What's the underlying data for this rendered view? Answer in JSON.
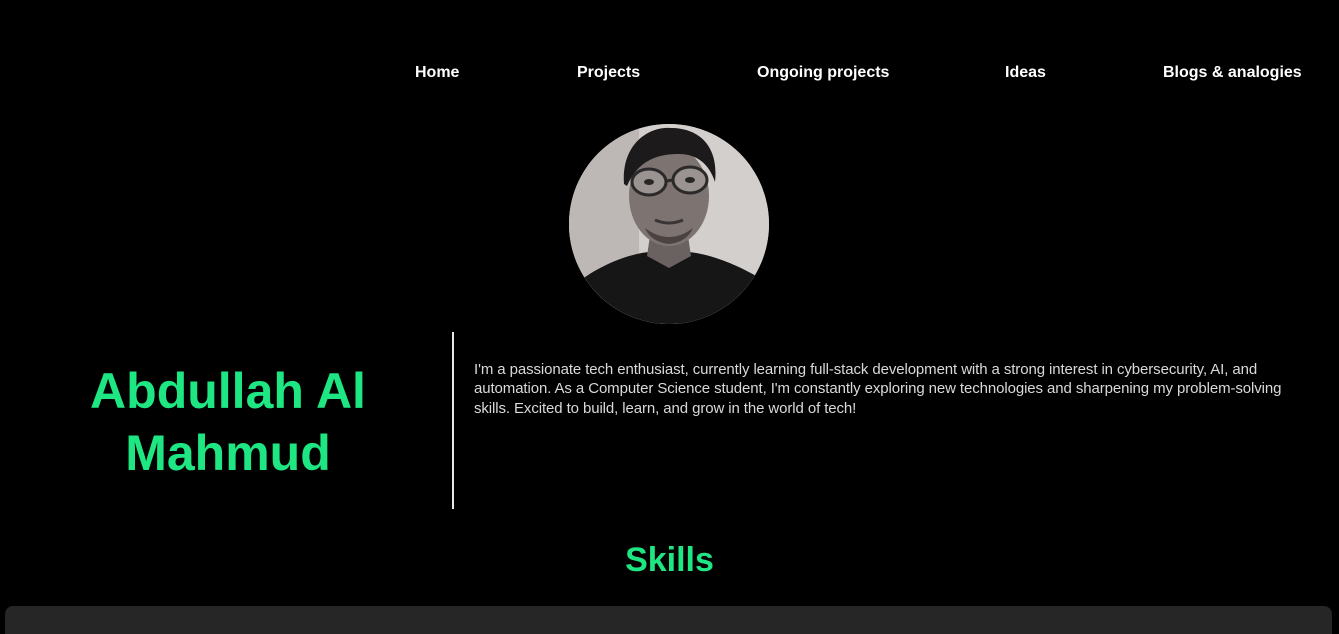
{
  "nav": {
    "items": [
      {
        "label": "Home"
      },
      {
        "label": "Projects"
      },
      {
        "label": "Ongoing projects"
      },
      {
        "label": "Ideas"
      },
      {
        "label": "Blogs & analogies"
      }
    ]
  },
  "profile": {
    "name_line1": "Abdullah Al",
    "name_line2": "Mahmud",
    "bio": "I'm a passionate tech enthusiast, currently learning full-stack development with a strong interest in cybersecurity, AI, and automation. As a Computer Science student, I'm constantly exploring new technologies and sharpening my problem-solving skills. Excited to build, learn, and grow in the world of tech!"
  },
  "skills": {
    "title": "Skills"
  },
  "colors": {
    "background": "#000000",
    "accent": "#1ee683",
    "nav_text": "#ffffff",
    "body_text": "#d9d9d9",
    "panel": "#262626"
  }
}
